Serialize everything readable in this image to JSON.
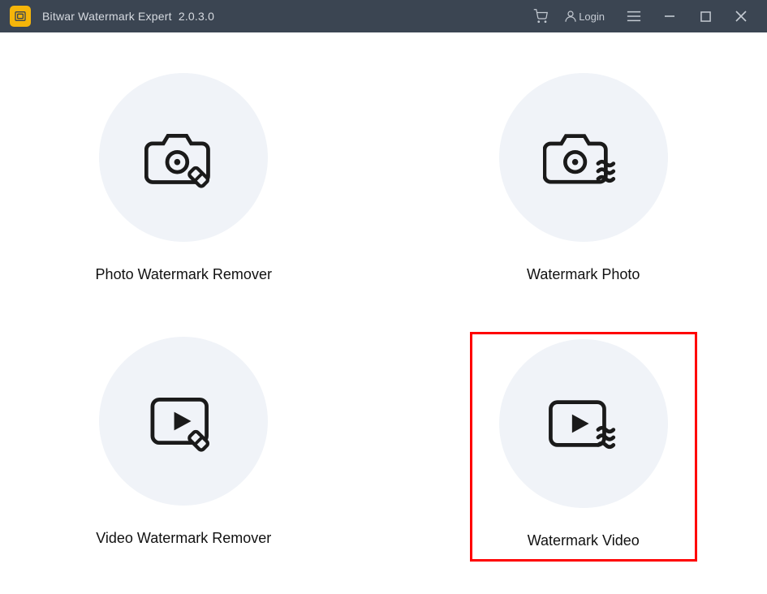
{
  "titlebar": {
    "app_name": "Bitwar Watermark Expert",
    "version": "2.0.3.0",
    "login_label": "Login"
  },
  "options": {
    "photo_remover": {
      "label": "Photo Watermark Remover"
    },
    "watermark_photo": {
      "label": "Watermark Photo"
    },
    "video_remover": {
      "label": "Video Watermark Remover"
    },
    "watermark_video": {
      "label": "Watermark Video"
    }
  }
}
